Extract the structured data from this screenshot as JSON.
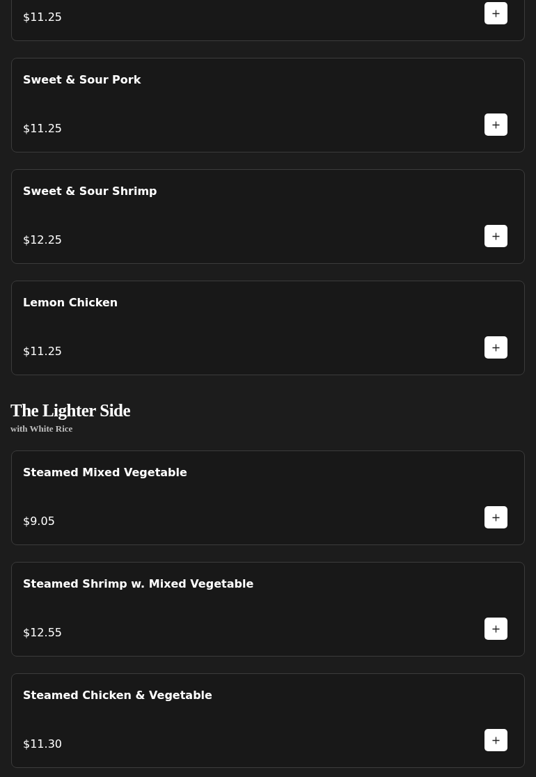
{
  "sections": [
    {
      "items": [
        {
          "price": "$11.25"
        },
        {
          "name": "Sweet & Sour Pork",
          "price": "$11.25"
        },
        {
          "name": "Sweet & Sour Shrimp",
          "price": "$12.25"
        },
        {
          "name": "Lemon Chicken",
          "price": "$11.25"
        }
      ]
    },
    {
      "title": "The Lighter Side",
      "subtitle": "with White Rice",
      "items": [
        {
          "name": "Steamed Mixed Vegetable",
          "price": "$9.05"
        },
        {
          "name": "Steamed Shrimp w. Mixed Vegetable",
          "price": "$12.55"
        },
        {
          "name": "Steamed Chicken & Vegetable",
          "price": "$11.30"
        }
      ]
    }
  ]
}
